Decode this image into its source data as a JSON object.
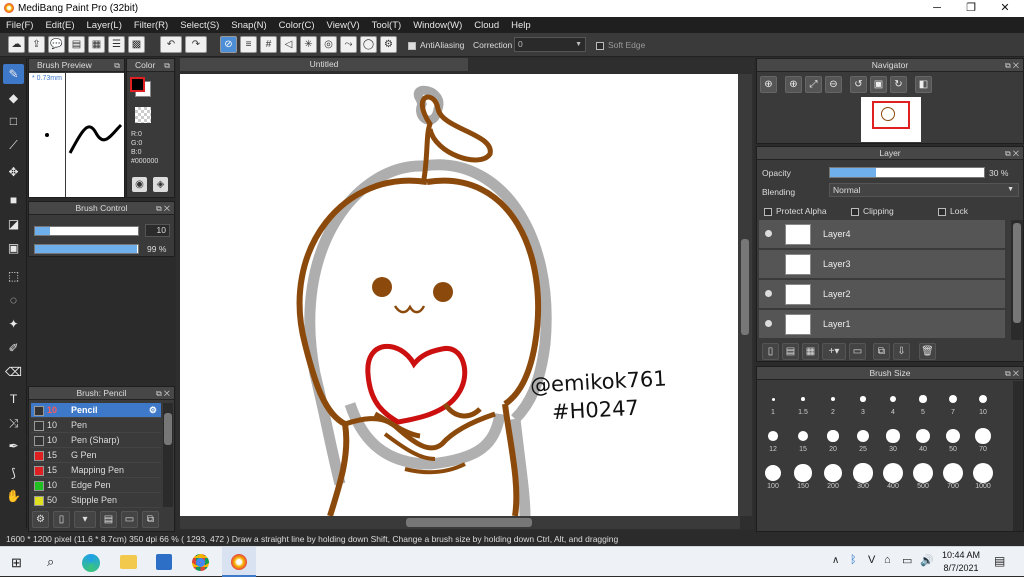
{
  "app": {
    "title": "MediBang Paint Pro (32bit)"
  },
  "menu": [
    "File(F)",
    "Edit(E)",
    "Layer(L)",
    "Filter(R)",
    "Select(S)",
    "Snap(N)",
    "Color(C)",
    "View(V)",
    "Tool(T)",
    "Window(W)",
    "Cloud",
    "Help"
  ],
  "toolbar": {
    "antialiasing_label": "AntiAliasing",
    "correction_label": "Correction",
    "correction_value": "0",
    "soft_edge_label": "Soft Edge"
  },
  "brush_preview": {
    "title": "Brush Preview",
    "size": "* 0.73mm"
  },
  "color_panel": {
    "title": "Color",
    "r": "R:0",
    "g": "G:0",
    "b": "B:0",
    "hex": "#000000",
    "fg_color": "#000000",
    "bg_color": "#ffffff"
  },
  "brush_control": {
    "title": "Brush Control",
    "size_value": "10",
    "opacity_value": "99 %",
    "opacity_fraction": 0.99,
    "size_fraction": 0.15
  },
  "canvas": {
    "tab_title": "Untitled",
    "signature_line1": "@emikok761",
    "signature_line2": "#H0247"
  },
  "brush_list": {
    "title": "Brush: Pencil",
    "items": [
      {
        "size": "10",
        "name": "Pencil",
        "color": "#333333",
        "selected": true
      },
      {
        "size": "10",
        "name": "Pen",
        "color": "#333333"
      },
      {
        "size": "10",
        "name": "Pen (Sharp)",
        "color": "#333333"
      },
      {
        "size": "15",
        "name": "G Pen",
        "color": "#e02020"
      },
      {
        "size": "15",
        "name": "Mapping Pen",
        "color": "#e02020"
      },
      {
        "size": "10",
        "name": "Edge Pen",
        "color": "#20c020"
      },
      {
        "size": "50",
        "name": "Stipple Pen",
        "color": "#e0e020"
      }
    ]
  },
  "navigator": {
    "title": "Navigator"
  },
  "layer_panel": {
    "title": "Layer",
    "opacity_label": "Opacity",
    "opacity_value": "30 %",
    "opacity_fraction": 0.3,
    "blending_label": "Blending",
    "blending_value": "Normal",
    "protect_alpha": "Protect Alpha",
    "clipping": "Clipping",
    "lock": "Lock",
    "layers": [
      {
        "name": "Layer4",
        "visible": true
      },
      {
        "name": "Layer3",
        "visible": false
      },
      {
        "name": "Layer2",
        "visible": true
      },
      {
        "name": "Layer1",
        "visible": true
      }
    ]
  },
  "brush_size": {
    "title": "Brush Size",
    "sizes": [
      "1",
      "1.5",
      "2",
      "3",
      "4",
      "5",
      "7",
      "10",
      "12",
      "15",
      "20",
      "25",
      "30",
      "40",
      "50",
      "70",
      "100",
      "150",
      "200",
      "300",
      "400",
      "500",
      "700",
      "1000"
    ]
  },
  "status": {
    "text": "1600 * 1200 pixel   (11.6 * 8.7cm)   350 dpi   66 %   ( 1293, 472 )   Draw a straight line by holding down Shift, Change a brush size by holding down Ctrl, Alt, and dragging"
  },
  "taskbar": {
    "time": "10:44 AM",
    "date": "8/7/2021"
  }
}
